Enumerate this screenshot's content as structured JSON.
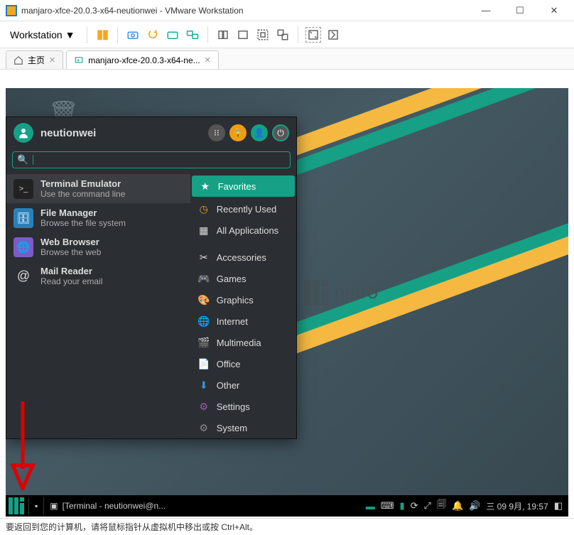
{
  "window": {
    "title": "manjaro-xfce-20.0.3-x64-neutionwei - VMware Workstation",
    "menu_label": "Workstation"
  },
  "tabs": {
    "home": "主页",
    "vm": "manjaro-xfce-20.0.3-x64-ne..."
  },
  "whisker": {
    "username": "neutionwei",
    "search_placeholder": "",
    "apps": [
      {
        "name": "Terminal Emulator",
        "desc": "Use the command line"
      },
      {
        "name": "File Manager",
        "desc": "Browse the file system"
      },
      {
        "name": "Web Browser",
        "desc": "Browse the web"
      },
      {
        "name": "Mail Reader",
        "desc": "Read your email"
      }
    ],
    "categories": [
      "Favorites",
      "Recently Used",
      "All Applications",
      "Accessories",
      "Games",
      "Graphics",
      "Internet",
      "Multimedia",
      "Office",
      "Other",
      "Settings",
      "System"
    ]
  },
  "taskbar": {
    "task": "[Terminal - neutionwei@n...",
    "clock": "三 09 9月, 19:57"
  },
  "statusbar": {
    "text": "要返回到您的计算机，请将鼠标指针从虚拟机中移出或按 Ctrl+Alt。"
  },
  "desktop": {
    "distro_text": "njaro"
  }
}
